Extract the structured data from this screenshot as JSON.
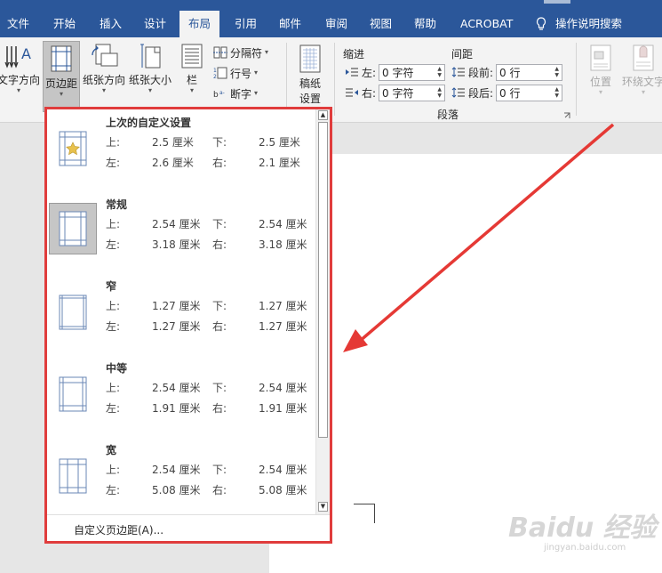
{
  "ribbon_tabs": [
    "文件",
    "开始",
    "插入",
    "设计",
    "布局",
    "引用",
    "邮件",
    "审阅",
    "视图",
    "帮助",
    "ACROBAT"
  ],
  "active_tab": "布局",
  "tell_me": "操作说明搜索",
  "page_setup": {
    "text_direction": "文字方向",
    "margins": "页边距",
    "orientation": "纸张方向",
    "size": "纸张大小",
    "columns": "栏",
    "breaks": "分隔符",
    "line_numbers": "行号",
    "hyphenation": "断字"
  },
  "draft": {
    "label_line1": "稿纸",
    "label_line2": "设置"
  },
  "paragraph": {
    "indent_label": "缩进",
    "spacing_label": "间距",
    "left_label": "左:",
    "left_value": "0 字符",
    "right_label": "右:",
    "right_value": "0 字符",
    "before_label": "段前:",
    "before_value": "0 行",
    "after_label": "段后:",
    "after_value": "0 行",
    "group_name": "段落"
  },
  "arrange": {
    "position": "位置",
    "wrap_text": "环绕文字"
  },
  "margin_presets": [
    {
      "name": "上次的自定义设置",
      "top_label": "上:",
      "top": "2.5 厘米",
      "bottom_label": "下:",
      "bottom": "2.5 厘米",
      "left_label": "左:",
      "left": "2.6 厘米",
      "right_label": "右:",
      "right": "2.1 厘米"
    },
    {
      "name": "常规",
      "top_label": "上:",
      "top": "2.54 厘米",
      "bottom_label": "下:",
      "bottom": "2.54 厘米",
      "left_label": "左:",
      "left": "3.18 厘米",
      "right_label": "右:",
      "right": "3.18 厘米"
    },
    {
      "name": "窄",
      "top_label": "上:",
      "top": "1.27 厘米",
      "bottom_label": "下:",
      "bottom": "1.27 厘米",
      "left_label": "左:",
      "left": "1.27 厘米",
      "right_label": "右:",
      "right": "1.27 厘米"
    },
    {
      "name": "中等",
      "top_label": "上:",
      "top": "2.54 厘米",
      "bottom_label": "下:",
      "bottom": "2.54 厘米",
      "left_label": "左:",
      "left": "1.91 厘米",
      "right_label": "右:",
      "right": "1.91 厘米"
    },
    {
      "name": "宽",
      "top_label": "上:",
      "top": "2.54 厘米",
      "bottom_label": "下:",
      "bottom": "2.54 厘米",
      "left_label": "左:",
      "left": "5.08 厘米",
      "right_label": "右:",
      "right": "5.08 厘米"
    }
  ],
  "custom_margins": "自定义页边距(A)...",
  "watermark": {
    "brand": "Baidu 经验",
    "url": "jingyan.baidu.com"
  },
  "colors": {
    "ribbon": "#2b579a",
    "highlight": "#e03c3c"
  }
}
